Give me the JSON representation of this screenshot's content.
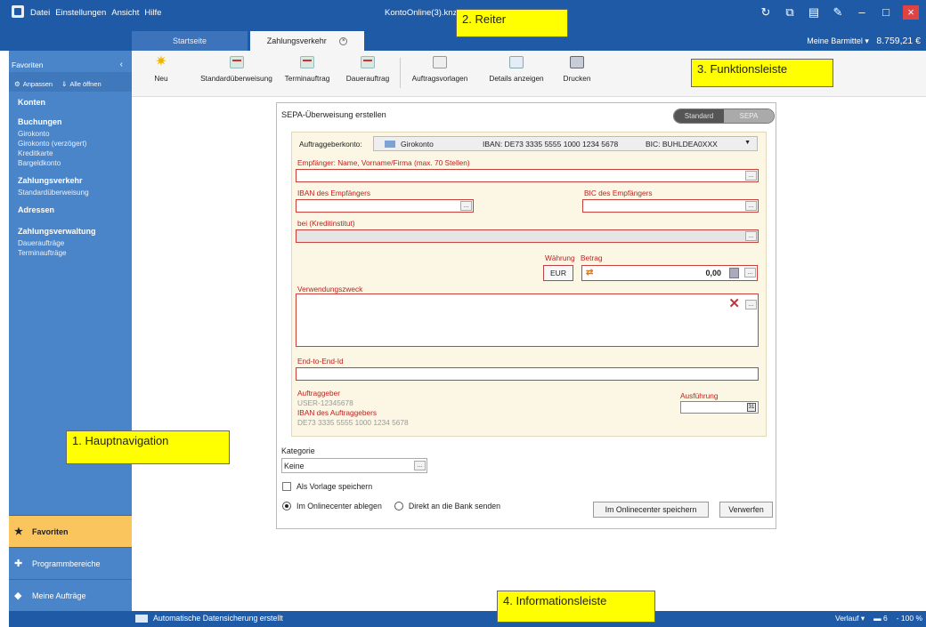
{
  "titlebar": {
    "menu": [
      "Datei",
      "Einstellungen",
      "Ansicht",
      "Hilfe"
    ],
    "window_title": "KontoOnline(3).knz -"
  },
  "tabs": [
    {
      "label": "Startseite",
      "active": false
    },
    {
      "label": "Zahlungsverkehr",
      "active": true
    }
  ],
  "barmittel": {
    "label": "Meine Barmittel ▾",
    "amount": "8.759,21 €"
  },
  "sidebar": {
    "header": "Favoriten",
    "actions": [
      "Anpassen",
      "Alle öffnen"
    ],
    "sections": [
      {
        "title": "Konten",
        "items": []
      },
      {
        "title": "Buchungen",
        "items": [
          "Girokonto",
          "Girokonto (verzögert)",
          "Kreditkarte",
          "Bargeldkonto"
        ]
      },
      {
        "title": "Zahlungsverkehr",
        "items": [
          "Standardüberweisung"
        ]
      },
      {
        "title": "Adressen",
        "items": []
      },
      {
        "title": "Zahlungsverwaltung",
        "items": [
          "Daueraufträge",
          "Terminaufträge"
        ]
      }
    ],
    "bottom": [
      "Favoriten",
      "Programmbereiche",
      "Meine Aufträge"
    ]
  },
  "toolbar": {
    "items": [
      "Neu",
      "Standardüberweisung",
      "Terminauftrag",
      "Dauerauftrag",
      "Auftragsvorlagen",
      "Details anzeigen",
      "Drucken"
    ]
  },
  "form": {
    "title": "SEPA-Überweisung erstellen",
    "toggle": [
      "Standard",
      "SEPA"
    ],
    "auftraggeberkonto_label": "Auftraggeberkonto:",
    "konto_name": "Girokonto",
    "konto_iban": "IBAN:  DE73 3335 5555 1000 1234 5678",
    "konto_bic": "BIC: BUHLDEA0XXX",
    "empfaenger_label": "Empfänger: Name, Vorname/Firma (max. 70 Stellen)",
    "iban_empf_label": "IBAN des Empfängers",
    "bic_empf_label": "BIC des Empfängers",
    "bei_label": "bei (Kreditinstitut)",
    "waehrung_label": "Währung",
    "betrag_label": "Betrag",
    "waehrung": "EUR",
    "betrag": "0,00",
    "zweck_label": "Verwendungszweck",
    "e2e_label": "End-to-End-Id",
    "auftraggeber_label": "Auftraggeber",
    "auftraggeber_value": "USER-12345678",
    "iban_auftr_label": "IBAN des Auftraggebers",
    "iban_auftr_value": "DE73 3335 5555 1000 1234 5678",
    "ausfuehrung_label": "Ausführung",
    "kategorie_label": "Kategorie",
    "kategorie_value": "Keine",
    "vorlage_label": "Als Vorlage speichern",
    "radio_online": "Im Onlinecenter ablegen",
    "radio_bank": "Direkt an die Bank senden",
    "btn_speichern": "Im Onlinecenter speichern",
    "btn_verwerfen": "Verwerfen"
  },
  "statusbar": {
    "message": "Automatische Datensicherung erstellt",
    "verlauf": "Verlauf ▾",
    "count": "6",
    "zoom": "- 100 %"
  },
  "annotations": {
    "reiter": "2. Reiter",
    "funktionsleiste": "3. Funktionsleiste",
    "hauptnavigation": "1. Hauptnavigation",
    "informationsleiste": "4. Informationsleiste"
  }
}
